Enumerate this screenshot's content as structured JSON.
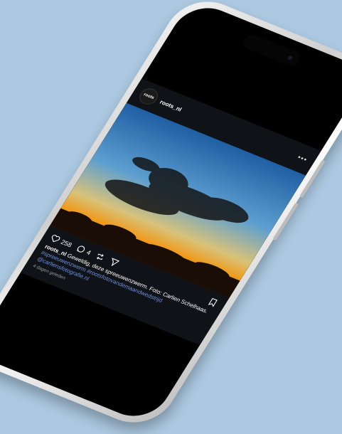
{
  "post": {
    "avatar_text": "roots",
    "username": "roots_nl",
    "more_label": "•••",
    "likes": "258",
    "comments": "4",
    "caption_user": "roots_nl",
    "caption_text": "Geweldig, deze spreeuwenzwerm. Foto: Carlien Schelhaas.",
    "hashtags": "#spreeuwenzwerm #rootsfotovandemaandwedstrijd",
    "mention": "@carliensfotografie.nl",
    "time": "4 dagen geleden"
  },
  "colors": {
    "background": "#acc9e1",
    "link": "#6f8fe0"
  },
  "icons": [
    "heart-icon",
    "comment-icon",
    "repost-icon",
    "share-icon",
    "bookmark-icon"
  ]
}
